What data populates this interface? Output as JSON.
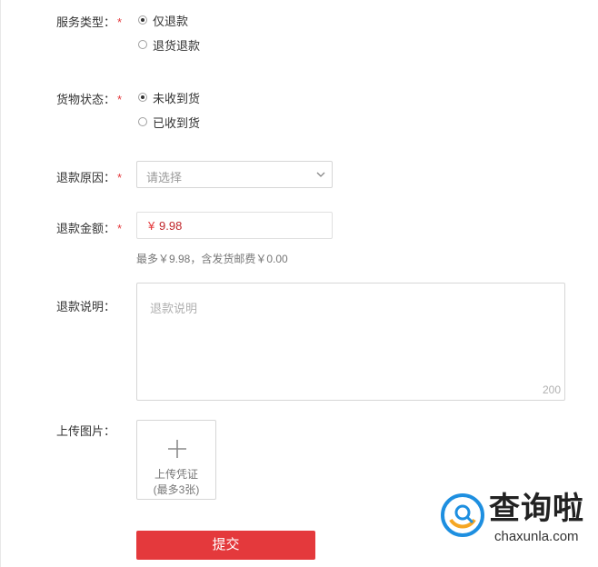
{
  "form": {
    "service_type": {
      "label": "服务类型：",
      "required_mark": "*",
      "options": [
        {
          "label": "仅退款",
          "checked": true
        },
        {
          "label": "退货退款",
          "checked": false
        }
      ]
    },
    "goods_status": {
      "label": "货物状态：",
      "required_mark": "*",
      "options": [
        {
          "label": "未收到货",
          "checked": true
        },
        {
          "label": "已收到货",
          "checked": false
        }
      ]
    },
    "refund_reason": {
      "label": "退款原因：",
      "required_mark": "*",
      "placeholder": "请选择",
      "icon": "chevron-down-icon"
    },
    "refund_amount": {
      "label": "退款金额：",
      "required_mark": "*",
      "currency": "¥",
      "value": "9.98",
      "hint": "最多￥9.98，含发货邮费￥0.00"
    },
    "refund_description": {
      "label": "退款说明：",
      "placeholder": "退款说明",
      "char_limit": "200"
    },
    "upload_images": {
      "label": "上传图片：",
      "icon": "plus-icon",
      "button_text": "上传凭证",
      "limit_text": "(最多3张)"
    },
    "submit_label": "提交"
  },
  "watermark": {
    "brand_cn": "查询啦",
    "brand_en": "chaxunla.com",
    "icon": "search-logo-icon",
    "colors": {
      "blue": "#1e8fe0",
      "orange": "#f5a623",
      "text": "#222222"
    }
  },
  "colors": {
    "accent_red": "#e4393c",
    "border": "#d6d6d6",
    "placeholder": "#999999"
  }
}
